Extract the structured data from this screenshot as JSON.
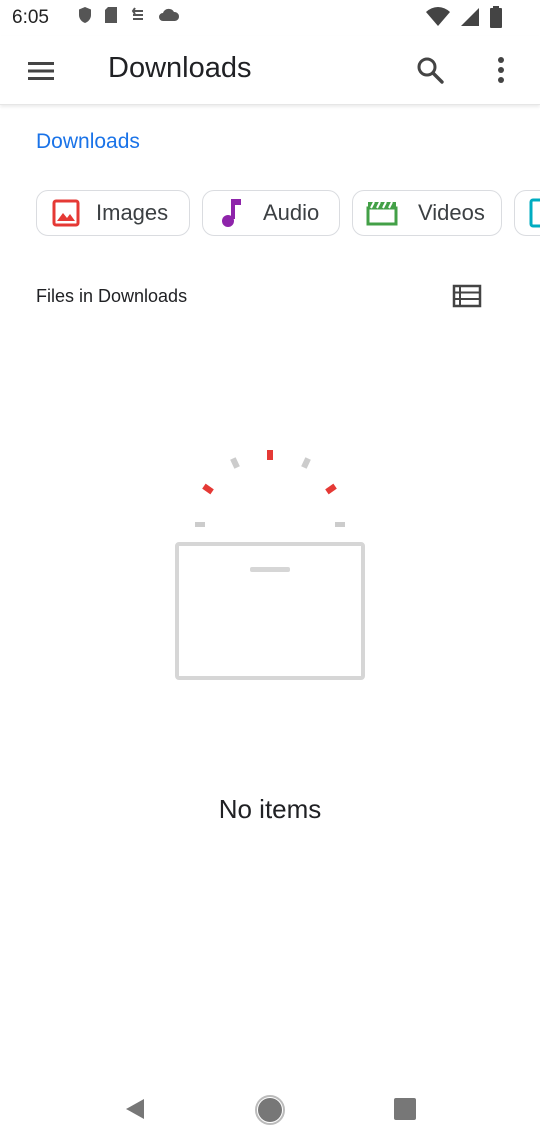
{
  "status_bar": {
    "time": "6:05"
  },
  "app_bar": {
    "title": "Downloads",
    "menu_icon": "hamburger-menu-icon",
    "search_icon": "search-icon",
    "more_icon": "more-vert-icon"
  },
  "breadcrumb": {
    "label": "Downloads"
  },
  "chips": [
    {
      "label": "Images",
      "icon": "image-icon",
      "color": "#e53935"
    },
    {
      "label": "Audio",
      "icon": "music-note-icon",
      "color": "#8e24aa"
    },
    {
      "label": "Videos",
      "icon": "movie-icon",
      "color": "#43a047"
    },
    {
      "label": "",
      "icon": "document-icon",
      "color": "#00acc1"
    }
  ],
  "section": {
    "title": "Files in Downloads",
    "view_toggle_icon": "list-view-icon"
  },
  "empty_state": {
    "message": "No items"
  },
  "colors": {
    "accent": "#1a73e8",
    "illustration_red": "#e53935",
    "illustration_gray": "#cccccc"
  }
}
